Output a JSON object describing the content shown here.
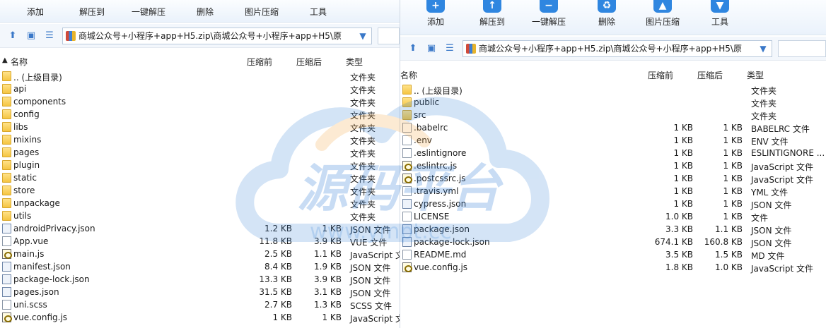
{
  "toolbar": {
    "buttons": [
      {
        "label": "添加",
        "icon": "add-icon"
      },
      {
        "label": "解压到",
        "icon": "extract-icon"
      },
      {
        "label": "一键解压",
        "icon": "one-click-extract-icon"
      },
      {
        "label": "删除",
        "icon": "delete-icon"
      },
      {
        "label": "图片压缩",
        "icon": "image-compress-icon"
      },
      {
        "label": "工具",
        "icon": "tools-icon"
      }
    ]
  },
  "address": {
    "path": "商城公众号+小程序+app+H5.zip\\商城公众号+小程序+app+H5\\原"
  },
  "columns": {
    "name": "名称",
    "packed": "压缩前",
    "unpacked": "压缩后",
    "type": "类型",
    "sort_indicator": "▲"
  },
  "left_list": [
    {
      "name": ".. (上级目录)",
      "before": "",
      "after": "",
      "type": "文件夹",
      "kind": "folder"
    },
    {
      "name": "api",
      "before": "",
      "after": "",
      "type": "文件夹",
      "kind": "folder"
    },
    {
      "name": "components",
      "before": "",
      "after": "",
      "type": "文件夹",
      "kind": "folder"
    },
    {
      "name": "config",
      "before": "",
      "after": "",
      "type": "文件夹",
      "kind": "folder"
    },
    {
      "name": "libs",
      "before": "",
      "after": "",
      "type": "文件夹",
      "kind": "folder"
    },
    {
      "name": "mixins",
      "before": "",
      "after": "",
      "type": "文件夹",
      "kind": "folder"
    },
    {
      "name": "pages",
      "before": "",
      "after": "",
      "type": "文件夹",
      "kind": "folder"
    },
    {
      "name": "plugin",
      "before": "",
      "after": "",
      "type": "文件夹",
      "kind": "folder"
    },
    {
      "name": "static",
      "before": "",
      "after": "",
      "type": "文件夹",
      "kind": "folder"
    },
    {
      "name": "store",
      "before": "",
      "after": "",
      "type": "文件夹",
      "kind": "folder"
    },
    {
      "name": "unpackage",
      "before": "",
      "after": "",
      "type": "文件夹",
      "kind": "folder"
    },
    {
      "name": "utils",
      "before": "",
      "after": "",
      "type": "文件夹",
      "kind": "folder"
    },
    {
      "name": "androidPrivacy.json",
      "before": "1.2 KB",
      "after": "1 KB",
      "type": "JSON 文件",
      "kind": "json"
    },
    {
      "name": "App.vue",
      "before": "11.8 KB",
      "after": "3.9 KB",
      "type": "VUE 文件",
      "kind": "file"
    },
    {
      "name": "main.js",
      "before": "2.5 KB",
      "after": "1.1 KB",
      "type": "JavaScript 文",
      "kind": "js"
    },
    {
      "name": "manifest.json",
      "before": "8.4 KB",
      "after": "1.9 KB",
      "type": "JSON 文件",
      "kind": "json"
    },
    {
      "name": "package-lock.json",
      "before": "13.3 KB",
      "after": "3.9 KB",
      "type": "JSON 文件",
      "kind": "json"
    },
    {
      "name": "pages.json",
      "before": "31.5 KB",
      "after": "3.1 KB",
      "type": "JSON 文件",
      "kind": "json"
    },
    {
      "name": "uni.scss",
      "before": "2.7 KB",
      "after": "1.3 KB",
      "type": "SCSS 文件",
      "kind": "file"
    },
    {
      "name": "vue.config.js",
      "before": "1 KB",
      "after": "1 KB",
      "type": "JavaScript 文",
      "kind": "js"
    }
  ],
  "right_list": [
    {
      "name": ".. (上级目录)",
      "before": "",
      "after": "",
      "type": "文件夹",
      "kind": "folder"
    },
    {
      "name": "public",
      "before": "",
      "after": "",
      "type": "文件夹",
      "kind": "folder"
    },
    {
      "name": "src",
      "before": "",
      "after": "",
      "type": "文件夹",
      "kind": "folder"
    },
    {
      "name": ".babelrc",
      "before": "1 KB",
      "after": "1 KB",
      "type": "BABELRC 文件",
      "kind": "file"
    },
    {
      "name": ".env",
      "before": "1 KB",
      "after": "1 KB",
      "type": "ENV 文件",
      "kind": "file"
    },
    {
      "name": ".eslintignore",
      "before": "1 KB",
      "after": "1 KB",
      "type": "ESLINTIGNORE ...",
      "kind": "file"
    },
    {
      "name": ".eslintrc.js",
      "before": "1 KB",
      "after": "1 KB",
      "type": "JavaScript 文件",
      "kind": "js"
    },
    {
      "name": ".postcssrc.js",
      "before": "1 KB",
      "after": "1 KB",
      "type": "JavaScript 文件",
      "kind": "js"
    },
    {
      "name": ".travis.yml",
      "before": "1 KB",
      "after": "1 KB",
      "type": "YML 文件",
      "kind": "file"
    },
    {
      "name": "cypress.json",
      "before": "1 KB",
      "after": "1 KB",
      "type": "JSON 文件",
      "kind": "json"
    },
    {
      "name": "LICENSE",
      "before": "1.0 KB",
      "after": "1 KB",
      "type": "文件",
      "kind": "file"
    },
    {
      "name": "package.json",
      "before": "3.3 KB",
      "after": "1.1 KB",
      "type": "JSON 文件",
      "kind": "json"
    },
    {
      "name": "package-lock.json",
      "before": "674.1 KB",
      "after": "160.8 KB",
      "type": "JSON 文件",
      "kind": "json"
    },
    {
      "name": "README.md",
      "before": "3.5 KB",
      "after": "1.5 KB",
      "type": "MD 文件",
      "kind": "file"
    },
    {
      "name": "vue.config.js",
      "before": "1.8 KB",
      "after": "1.0 KB",
      "type": "JavaScript 文件",
      "kind": "js"
    }
  ],
  "watermark": {
    "title": "源码平台",
    "url": "www.ympt.cc"
  },
  "colors": {
    "accent": "#2f86e0",
    "folder": "#f5c542",
    "watermark_blue": "#3d86d8",
    "watermark_orange": "#f2a23a"
  }
}
